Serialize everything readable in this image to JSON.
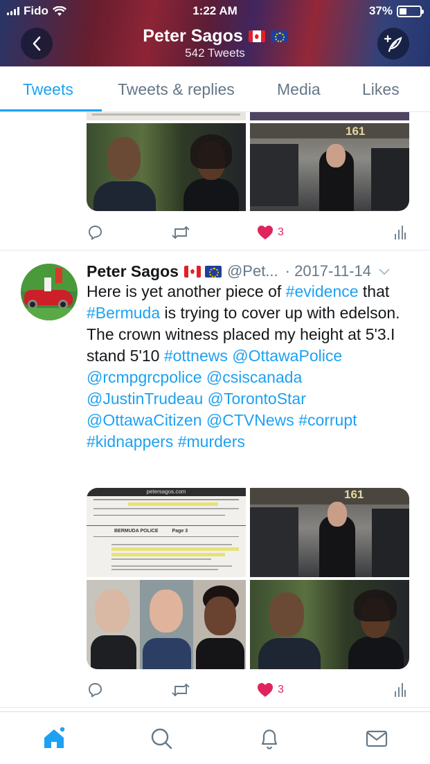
{
  "status_bar": {
    "carrier": "Fido",
    "time": "1:22 AM",
    "battery": "37%",
    "battery_level": 0.37
  },
  "header": {
    "name": "Peter Sagos",
    "subtitle": "542 Tweets"
  },
  "tabs": [
    {
      "label": "Tweets",
      "active": true
    },
    {
      "label": "Tweets & replies",
      "active": false
    },
    {
      "label": "Media",
      "active": false
    },
    {
      "label": "Likes",
      "active": false
    }
  ],
  "tweets": [
    {
      "like_count": "3"
    },
    {
      "author": "Peter Sagos",
      "handle": "@Pet...",
      "date": "· 2017-11-14",
      "segments": [
        {
          "t": "Here is yet another piece of ",
          "link": false
        },
        {
          "t": "#evidence",
          "link": true
        },
        {
          "t": " that ",
          "link": false
        },
        {
          "t": "#Bermuda",
          "link": true
        },
        {
          "t": " is trying to cover up with edelson. The crown witness placed my height at 5'3.I stand 5'10 ",
          "link": false
        },
        {
          "t": "#ottnews",
          "link": true
        },
        {
          "t": " ",
          "link": false
        },
        {
          "t": "@OttawaPolice",
          "link": true
        },
        {
          "t": " ",
          "link": false
        },
        {
          "t": "@rcmpgrcpolice",
          "link": true
        },
        {
          "t": " ",
          "link": false
        },
        {
          "t": "@csiscanada",
          "link": true
        },
        {
          "t": " ",
          "link": false
        },
        {
          "t": "@JustinTrudeau",
          "link": true
        },
        {
          "t": " ",
          "link": false
        },
        {
          "t": "@TorontoStar",
          "link": true
        },
        {
          "t": " ",
          "link": false
        },
        {
          "t": "@OttawaCitizen",
          "link": true
        },
        {
          "t": " ",
          "link": false
        },
        {
          "t": "@CTVNews",
          "link": true
        },
        {
          "t": " ",
          "link": false
        },
        {
          "t": "#corrupt",
          "link": true
        },
        {
          "t": "  ",
          "link": false
        },
        {
          "t": "#kidnappers",
          "link": true
        },
        {
          "t": " ",
          "link": false
        },
        {
          "t": "#murders",
          "link": true
        }
      ],
      "like_count": "3",
      "media": {
        "doc_header": "petersagos.com",
        "doc_title": "BERMUDA POLICE",
        "doc_page": "Page 3"
      }
    }
  ],
  "photo_labels": {
    "number": "161"
  },
  "colors": {
    "accent": "#1da1f2",
    "like": "#e0245e",
    "muted": "#657786"
  },
  "bottom_nav": [
    "home-icon",
    "search-icon",
    "notifications-icon",
    "messages-icon"
  ]
}
